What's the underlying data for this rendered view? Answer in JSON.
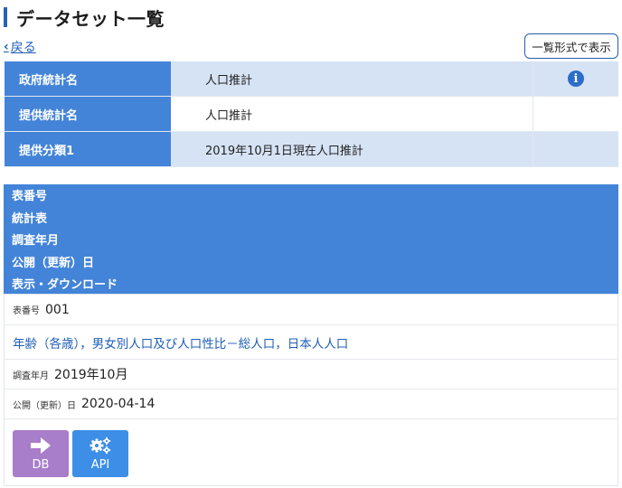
{
  "page": {
    "title": "データセット一覧",
    "back_label": "戻る",
    "list_format_button": "一覧形式で表示"
  },
  "info_table": [
    {
      "label": "政府統計名",
      "value": "人口推計"
    },
    {
      "label": "提供統計名",
      "value": "人口推計"
    },
    {
      "label": "提供分類1",
      "value": "2019年10月1日現在人口推計"
    }
  ],
  "dataset_header": {
    "table_number": "表番号",
    "stat_table": "統計表",
    "survey_month": "調査年月",
    "release_date": "公開（更新）日",
    "display_download": "表示・ダウンロード"
  },
  "dataset": {
    "table_number_label": "表番号",
    "table_number_value": "001",
    "table_title": "年齢（各歳），男女別人口及び人口性比－総人口，日本人人口",
    "survey_month_label": "調査年月",
    "survey_month_value": "2019年10月",
    "release_label": "公開（更新）日",
    "release_value": "2020-04-14",
    "db_button": "DB",
    "api_button": "API"
  },
  "colors": {
    "header_blue": "#4384d8",
    "row_light_blue": "#d6e3f5",
    "link_blue": "#1f5fb6",
    "db_purple": "#a87dc9",
    "api_blue": "#3c8ee6"
  },
  "icons": {
    "back": "chevron-left-icon",
    "info": "info-circle-icon",
    "db": "arrow-right-icon",
    "api": "gears-icon"
  }
}
